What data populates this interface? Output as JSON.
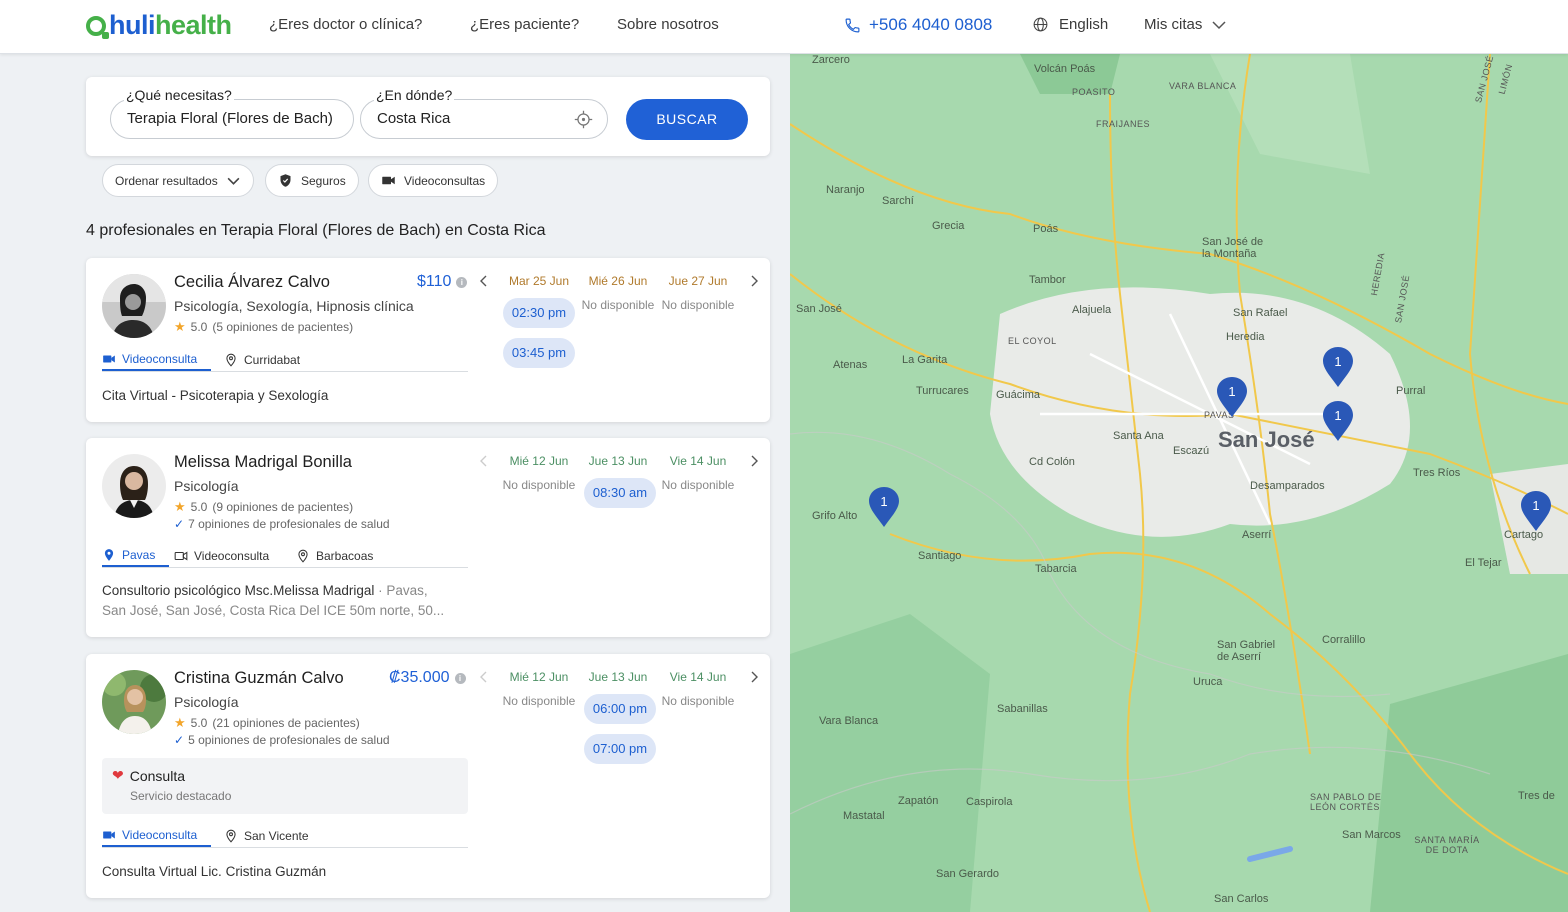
{
  "header": {
    "logo_huli": "huli",
    "logo_health": "health",
    "nav": [
      "¿Eres doctor o clínica?",
      "¿Eres paciente?",
      "Sobre nosotros"
    ],
    "phone": "+506 4040 0808",
    "language": "English",
    "account": "Mis citas"
  },
  "search": {
    "need_label": "¿Qué necesitas?",
    "need_value": "Terapia Floral (Flores de Bach)",
    "where_label": "¿En dónde?",
    "where_value": "Costa Rica",
    "button": "BUSCAR"
  },
  "filters": {
    "sort": "Ordenar resultados",
    "insurance": "Seguros",
    "video": "Videoconsultas"
  },
  "results_title": "4 profesionales en Terapia Floral (Flores de Bach) en Costa Rica",
  "doctors": [
    {
      "name": "Cecilia Álvarez Calvo",
      "specialties": "Psicología, Sexología, Hipnosis clínica",
      "rating": "5.0",
      "reviews": "(5 opiniones de pacientes)",
      "price": "$110",
      "tab_video": "Videoconsulta",
      "tab_location": "Curridabat",
      "address": "Cita Virtual - Psicoterapia y Sexología",
      "days": [
        "Mar 25 Jun",
        "Mié 26 Jun",
        "Jue 27 Jun"
      ],
      "slots": [
        "02:30 pm",
        "03:45 pm"
      ],
      "na": "No disponible"
    },
    {
      "name": "Melissa Madrigal Bonilla",
      "specialties": "Psicología",
      "rating": "5.0",
      "reviews": "(9 opiniones de pacientes)",
      "verified": "7 opiniones de profesionales de salud",
      "tab_pavas": "Pavas",
      "tab_video": "Videoconsulta",
      "tab_location": "Barbacoas",
      "address_main": "Consultorio psicológico Msc.Melissa Madrigal",
      "address_sep": " · ",
      "address_rest": "Pavas,",
      "address_line2": "San José, San José, Costa Rica Del ICE 50m norte, 50...",
      "days": [
        "Mié 12 Jun",
        "Jue 13 Jun",
        "Vie 14 Jun"
      ],
      "slots": [
        "08:30 am"
      ],
      "na": "No disponible"
    },
    {
      "name": "Cristina Guzmán Calvo",
      "specialties": "Psicología",
      "rating": "5.0",
      "reviews": "(21 opiniones de pacientes)",
      "verified": "5 opiniones de profesionales de salud",
      "price": "₡35.000",
      "featured_title": "Consulta",
      "featured_sub": "Servicio destacado",
      "tab_video": "Videoconsulta",
      "tab_location": "San Vicente",
      "address": "Consulta Virtual Lic. Cristina Guzmán",
      "days": [
        "Mié 12 Jun",
        "Jue 13 Jun",
        "Vie 14 Jun"
      ],
      "slots": [
        "06:00 pm",
        "07:00 pm"
      ],
      "na": "No disponible"
    }
  ],
  "map": {
    "labels": [
      "Zarcero",
      "Volcán Poás",
      "POASITO",
      "VARA BLANCA",
      "FRAIJANES",
      "Naranjo",
      "Sarchí",
      "Grecia",
      "Poás",
      "San José de la Montaña",
      "Tambor",
      "Alajuela",
      "San Rafael",
      "HEREDIA",
      "SAN JOSÉ",
      "San José",
      "EL COYOL",
      "Heredia",
      "La Garita",
      "Atenas",
      "Turrucares",
      "Guácima",
      "Purral",
      "PAVAS",
      "Santa Ana",
      "Escazú",
      "San José",
      "Cd Colón",
      "Tres Ríos",
      "Desamparados",
      "Grifo Alto",
      "Santiago",
      "Aserrí",
      "Cartago",
      "El Tejar",
      "Tabarcia",
      "San Gabriel de Aserrí",
      "Corralillo",
      "Uruca",
      "Sabanillas",
      "Vara Blanca",
      "Zapatón",
      "Caspirola",
      "Mastatal",
      "SAN PABLO DE LEÓN CORTÉS",
      "San Marcos",
      "SANTA MARÍA DE DOTA",
      "San Gerardo",
      "San Carlos",
      "Tres de",
      "LIMÓN",
      "SAN JOSÉ"
    ],
    "pin_count": "1"
  }
}
